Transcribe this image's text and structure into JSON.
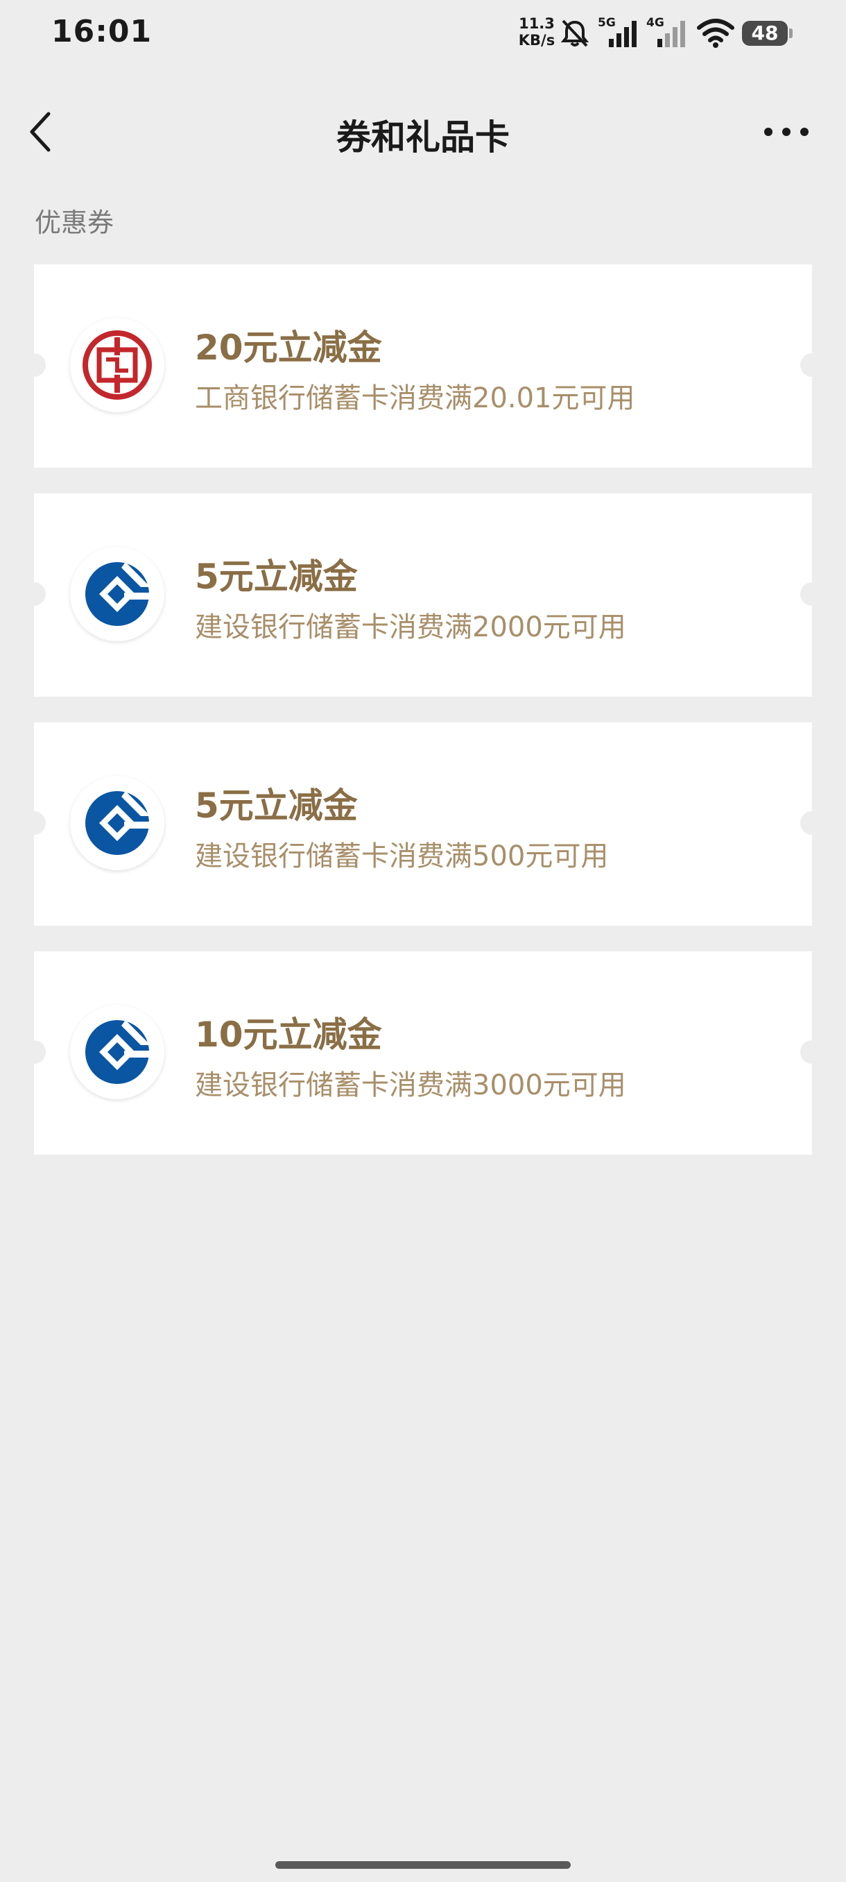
{
  "status_bar": {
    "time": "16:01",
    "net_speed_value": "11.3",
    "net_speed_unit": "KB/s",
    "signal1_label": "5G",
    "signal2_label": "4G",
    "battery": "48"
  },
  "header": {
    "title": "券和礼品卡",
    "back_icon": "chevron-left-icon",
    "more_icon": "more-dots-icon"
  },
  "section_label": "优惠券",
  "coupons": [
    {
      "title": "20元立减金",
      "description": "工商银行储蓄卡消费满20.01元可用",
      "bank_logo": "icbc-logo"
    },
    {
      "title": "5元立减金",
      "description": "建设银行储蓄卡消费满2000元可用",
      "bank_logo": "ccb-logo"
    },
    {
      "title": "5元立减金",
      "description": "建设银行储蓄卡消费满500元可用",
      "bank_logo": "ccb-logo"
    },
    {
      "title": "10元立减金",
      "description": "建设银行储蓄卡消费满3000元可用",
      "bank_logo": "ccb-logo"
    }
  ],
  "colors": {
    "background": "#ededed",
    "coupon_title": "#8a6e45",
    "coupon_desc": "#a88f6a",
    "icbc_red": "#c3272b",
    "ccb_blue": "#0a56a3"
  }
}
